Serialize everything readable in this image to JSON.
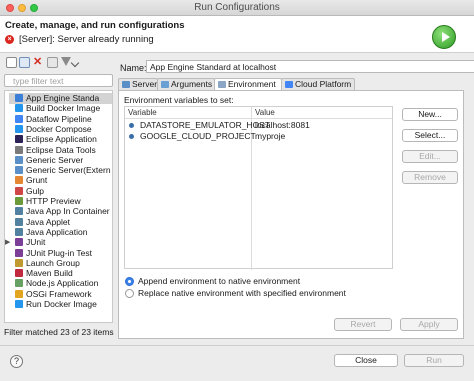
{
  "window": {
    "title": "Run Configurations"
  },
  "header": {
    "title": "Create, manage, and run configurations",
    "message": "[Server]: Server already running",
    "error_icon_glyph": "×",
    "run_icon": "run-icon"
  },
  "left_toolbar": {
    "icons": [
      "new-config-icon",
      "duplicate-icon",
      "delete-icon",
      "filter-icon",
      "collapse-all-icon"
    ]
  },
  "filter": {
    "placeholder": "type filter text"
  },
  "tree": {
    "items": [
      {
        "label": "App Engine Standa",
        "icon": "app-engine-icon",
        "color": "#3b7fd9",
        "selected": true
      },
      {
        "label": "Build Docker Image",
        "icon": "docker-icon",
        "color": "#2496ed"
      },
      {
        "label": "Dataflow Pipeline",
        "icon": "dataflow-icon",
        "color": "#4285f4"
      },
      {
        "label": "Docker Compose",
        "icon": "docker-icon",
        "color": "#2496ed"
      },
      {
        "label": "Eclipse Application",
        "icon": "eclipse-icon",
        "color": "#2c2255"
      },
      {
        "label": "Eclipse Data Tools",
        "icon": "database-icon",
        "color": "#7a7a7a"
      },
      {
        "label": "Generic Server",
        "icon": "server-icon",
        "color": "#5b8fc7"
      },
      {
        "label": "Generic Server(Extern",
        "icon": "server-icon",
        "color": "#5b8fc7"
      },
      {
        "label": "Grunt",
        "icon": "grunt-icon",
        "color": "#e48632"
      },
      {
        "label": "Gulp",
        "icon": "gulp-icon",
        "color": "#cf4647"
      },
      {
        "label": "HTTP Preview",
        "icon": "http-icon",
        "color": "#6a9a3a"
      },
      {
        "label": "Java App In Container",
        "icon": "java-icon",
        "color": "#5382a1"
      },
      {
        "label": "Java Applet",
        "icon": "applet-icon",
        "color": "#5382a1"
      },
      {
        "label": "Java Application",
        "icon": "java-app-icon",
        "color": "#5382a1"
      },
      {
        "label": "JUnit",
        "icon": "junit-icon",
        "color": "#7b3f98",
        "expandable": true
      },
      {
        "label": "JUnit Plug-in Test",
        "icon": "junit-icon",
        "color": "#7b3f98"
      },
      {
        "label": "Launch Group",
        "icon": "launch-group-icon",
        "color": "#c09a30"
      },
      {
        "label": "Maven Build",
        "icon": "maven-icon",
        "color": "#c2293f"
      },
      {
        "label": "Node.js Application",
        "icon": "nodejs-icon",
        "color": "#689f63"
      },
      {
        "label": "OSGi Framework",
        "icon": "osgi-icon",
        "color": "#e2a51f"
      },
      {
        "label": "Run Docker Image",
        "icon": "docker-icon",
        "color": "#2496ed"
      }
    ]
  },
  "filter_status": "Filter matched 23 of 23 items",
  "config": {
    "name_label": "Name:",
    "name_value": "App Engine Standard at localhost",
    "tabs": [
      {
        "label": "Server",
        "icon": "server-tab-icon",
        "color": "#5b8fc7"
      },
      {
        "label": "Arguments",
        "icon": "arguments-icon",
        "color": "#6aa0d4"
      },
      {
        "label": "Environment",
        "icon": "environment-icon",
        "color": "#8aa6c4",
        "active": true
      },
      {
        "label": "Cloud Platform",
        "icon": "cloud-platform-icon",
        "color": "#4285f4"
      }
    ]
  },
  "environment": {
    "label": "Environment variables to set:",
    "columns": [
      "Variable",
      "Value"
    ],
    "rows": [
      {
        "variable": "DATASTORE_EMULATOR_HOST",
        "value": "localhost:8081"
      },
      {
        "variable": "GOOGLE_CLOUD_PROJECT",
        "value": "myproje"
      }
    ],
    "buttons": {
      "new": "New...",
      "select": "Select...",
      "edit": "Edit...",
      "remove": "Remove"
    },
    "append_option": "Append environment to native environment",
    "replace_option": "Replace native environment with specified environment",
    "selected_option": "append"
  },
  "actions": {
    "revert": "Revert",
    "apply": "Apply",
    "close": "Close",
    "run": "Run"
  }
}
